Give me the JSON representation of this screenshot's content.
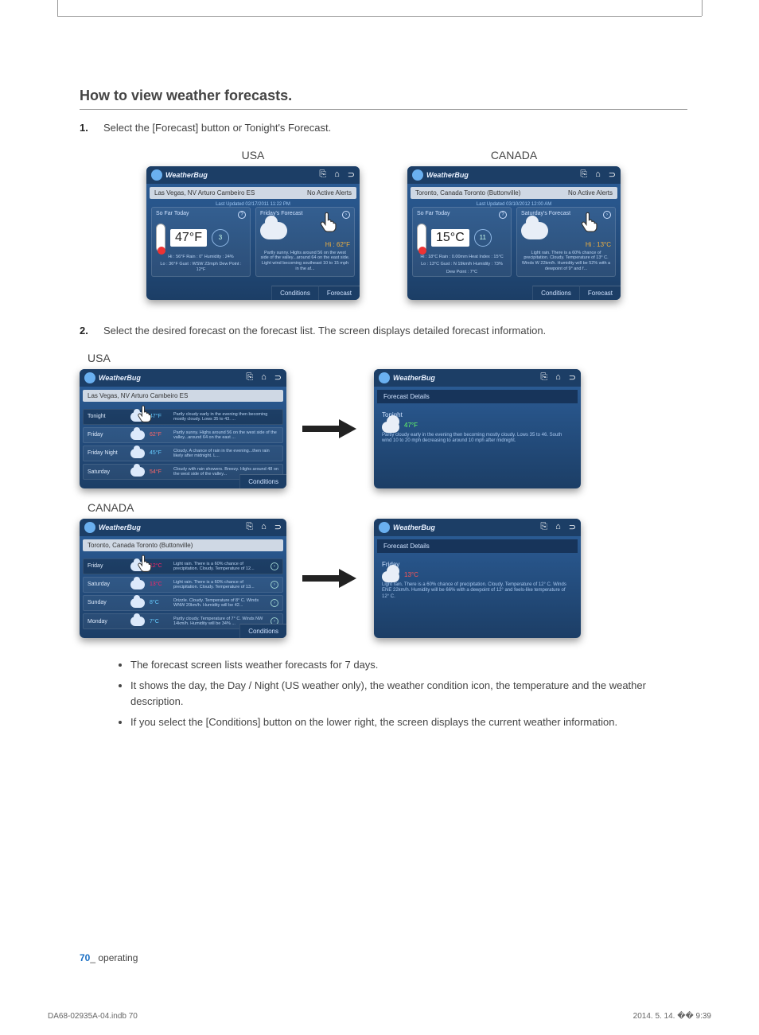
{
  "heading": "How to view weather forecasts.",
  "steps": {
    "s1": {
      "num": "1.",
      "text": "Select the [Forecast] button or Tonight's Forecast."
    },
    "s2": {
      "num": "2.",
      "text": "Select the desired forecast on the forecast list. The screen displays detailed forecast information."
    }
  },
  "labels": {
    "usa": "USA",
    "canada": "CANADA"
  },
  "brand": "WeatherBug",
  "alerts": "No Active Alerts",
  "usa_top": {
    "location": "Las Vegas, NV Arturo Cambeiro ES",
    "updated": "Last Updated 02/17/2011 11:22 PM",
    "panel1": "So Far Today",
    "temp": "47°F",
    "wind": "3",
    "line1": "Hi : 56°F    Rain : 0\"            Humidity : 24%",
    "line2": "Lo : 36°F    Gust : WSW 23mph  Dew Point : 12°F",
    "panel2": "Friday's Forecast",
    "hi": "Hi : 62°F",
    "desc": "Partly sunny. Highs around 56 on the west side of the valley...around 64 on the east side. Light wind becoming southeast 10 to 15 mph in the af..."
  },
  "canada_top": {
    "location": "Toronto, Canada Toronto (Buttonville)",
    "updated": "Last Updated 03/10/2012 12:00 AM",
    "panel1": "So Far Today",
    "temp": "15°C",
    "wind": "11",
    "line1": "Hi : 18°C    Rain : 0.00mm      Heat Index : 15°C",
    "line2": "Lo : 13°C    Gust : N 19km/h   Humidity : 73%",
    "line3": "Dew Point : 7°C",
    "panel2": "Saturday's Forecast",
    "hi": "Hi : 13°C",
    "desc": "Light rain.  There is a 60% chance of precipitation.  Cloudy.  Temperature of 13° C.  Winds W 22km/h.  Humidity will be 52% with a dewpoint of 9°  and f..."
  },
  "tabs": {
    "conditions": "Conditions",
    "forecast": "Forecast"
  },
  "usa_list": {
    "location": "Las Vegas, NV Arturo Cambeiro ES",
    "rows": [
      {
        "day": "Tonight",
        "temp": "47°F",
        "cls": "cool",
        "desc": "Partly cloudy early in the evening then becoming mostly cloudy. Lows 35 to 43. ..."
      },
      {
        "day": "Friday",
        "temp": "62°F",
        "cls": "warm",
        "desc": "Partly sunny. Highs around 56 on the west side of the valley...around 64 on the east ..."
      },
      {
        "day": "Friday Night",
        "temp": "45°F",
        "cls": "cool",
        "desc": "Cloudy. A chance of rain in the evening...then rain likely after midnight. L..."
      },
      {
        "day": "Saturday",
        "temp": "54°F",
        "cls": "warm",
        "desc": "Cloudy with rain showers. Breezy. Highs around 48 on the west side of the valley..."
      }
    ]
  },
  "usa_detail": {
    "title": "Forecast Details",
    "day": "Tonight",
    "temp": "47°F",
    "text": "Partly cloudy early in the evening then becoming mostly cloudy. Lows 35 to 46. South wind 10 to 20 mph decreasing to around 10 mph after midnight."
  },
  "canada_list": {
    "location": "Toronto, Canada Toronto (Buttonville)",
    "rows": [
      {
        "day": "Friday",
        "temp": "12°C",
        "cls": "hot",
        "desc": "Light rain.  There is a 60% chance of precipitation.  Cloudy.  Temperature of 12..."
      },
      {
        "day": "Saturday",
        "temp": "13°C",
        "cls": "hot",
        "desc": "Light rain.  There is a 60% chance of precipitation.  Cloudy.  Temperature of 13..."
      },
      {
        "day": "Sunday",
        "temp": "8°C",
        "cls": "cool",
        "desc": "Drizzle.  Cloudy.  Temperature of 8° C.  Winds WNW 20km/h.  Humidity will be 42..."
      },
      {
        "day": "Monday",
        "temp": "7°C",
        "cls": "cool",
        "desc": "Partly cloudy.  Temperature of 7° C.  Winds NW 14km/h.  Humidity will be 34% ..."
      }
    ]
  },
  "canada_detail": {
    "title": "Forecast Details",
    "day": "Friday",
    "temp": "13°C",
    "text": "Light rain.  There is a 60% chance of precipitation.  Cloudy.  Temperature of 12° C.  Winds ENE 22km/h.  Humidity will be 66% with a dewpoint of 12°  and feels-like temperature of 12° C."
  },
  "bullets": [
    "The forecast screen lists weather forecasts for 7 days.",
    "It shows the day, the Day / Night (US weather only), the weather condition icon, the temperature and the weather description.",
    "If you select the [Conditions] button on the lower right, the screen displays the current weather information."
  ],
  "footer": {
    "page": "70",
    "section": "_ operating"
  },
  "docfooter": {
    "left": "DA68-02935A-04.indb   70",
    "right": "2014. 5. 14.   �� 9:39"
  }
}
